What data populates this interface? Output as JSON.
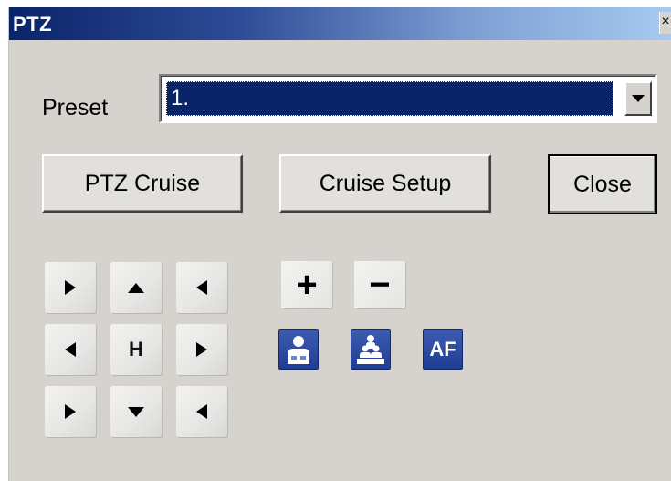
{
  "window": {
    "title": "PTZ",
    "close_glyph": "×"
  },
  "preset": {
    "label": "Preset",
    "selected": "1."
  },
  "buttons": {
    "cruise": "PTZ Cruise",
    "cruise_setup": "Cruise Setup",
    "close": "Close"
  },
  "direction_pad": {
    "home_label": "H",
    "icons": [
      "arrow-up-left-icon",
      "arrow-up-icon",
      "arrow-up-right-icon",
      "arrow-left-icon",
      "home-icon",
      "arrow-right-icon",
      "arrow-down-left-icon",
      "arrow-down-icon",
      "arrow-down-right-icon"
    ]
  },
  "zoom": {
    "in_glyph": "+",
    "out_glyph": "−"
  },
  "focus": {
    "near_icon": "focus-near-icon",
    "far_icon": "focus-far-icon",
    "auto_label": "AF"
  },
  "colors": {
    "titlebar_start": "#0a246a",
    "titlebar_end": "#a6caf0",
    "selection_bg": "#0a246a",
    "dialog_bg": "#d6d3ce",
    "focus_button": "#2a4aa3"
  }
}
